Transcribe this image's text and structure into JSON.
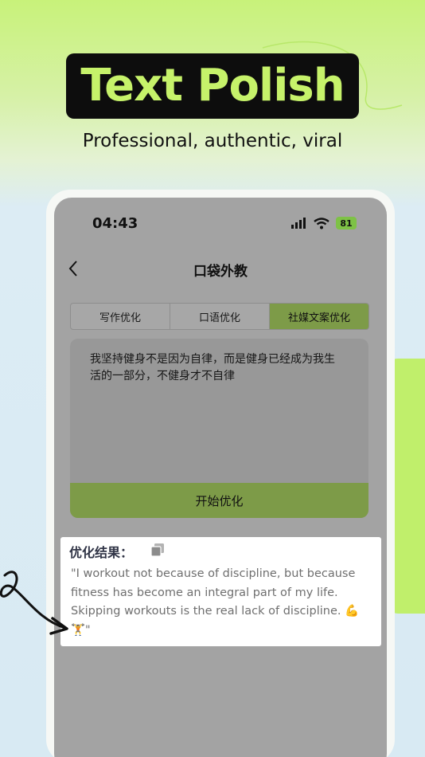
{
  "hero": {
    "title": "Text Polish",
    "subtitle": "Professional, authentic, viral"
  },
  "status_bar": {
    "time": "04:43",
    "battery": "81",
    "icons": [
      "signal-icon",
      "wifi-icon",
      "battery-icon"
    ]
  },
  "nav": {
    "back_icon": "chevron-left-icon",
    "title": "口袋外教"
  },
  "tabs": [
    {
      "label": "写作优化",
      "active": false
    },
    {
      "label": "口语优化",
      "active": false
    },
    {
      "label": "社媒文案优化",
      "active": true
    }
  ],
  "input": {
    "text": "我坚持健身不是因为自律，而是健身已经成为我生活的一部分，不健身才不自律"
  },
  "start_button": {
    "label": "开始优化"
  },
  "result": {
    "title": "优化结果：",
    "copy_icon": "copy-icon",
    "text": "\"I workout not because of discipline, but because fitness has become an integral part of my life. Skipping workouts is the real lack of discipline. 💪🏋️\""
  },
  "colors": {
    "accent_green": "#c6f26a",
    "tab_active": "#7d9b48",
    "badge_bg": "#0d0d0d"
  }
}
